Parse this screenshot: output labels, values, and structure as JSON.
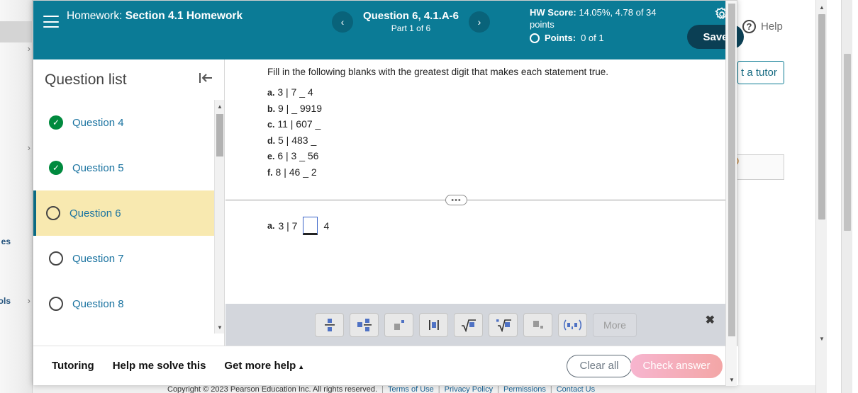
{
  "background": {
    "left_rail": {
      "fragment_1": "es",
      "fragment_2": "ols",
      "chevron": "›"
    },
    "help_label": "Help",
    "help_icon_glyph": "?",
    "tutor_button_label": "t a tutor",
    "inner_box_text": ")"
  },
  "footer": {
    "copyright": "Copyright © 2023 Pearson Education Inc. All rights reserved.",
    "links": [
      "Terms of Use",
      "Privacy Policy",
      "Permissions",
      "Contact Us"
    ],
    "separator": "|"
  },
  "header": {
    "menu_icon": "hamburger-icon",
    "assignment_prefix": "Homework:",
    "assignment_name": "Section 4.1 Homework",
    "prev_glyph": "‹",
    "next_glyph": "›",
    "question_title": "Question 6, 4.1.A-6",
    "part_label": "Part 1 of 6",
    "hw_score_label": "HW Score:",
    "hw_score_value": "14.05%, 4.78 of 34 points",
    "points_label": "Points:",
    "points_value": "0 of 1",
    "settings_icon": "gear-icon",
    "save_label": "Save",
    "accent_color": "#0b7b96",
    "save_color": "#0b3f54"
  },
  "question_list": {
    "title": "Question list",
    "collapse_icon": "collapse-left-icon",
    "items": [
      {
        "label": "Question 4",
        "state": "done",
        "active": false
      },
      {
        "label": "Question 5",
        "state": "done",
        "active": false
      },
      {
        "label": "Question 6",
        "state": "open",
        "active": true
      },
      {
        "label": "Question 7",
        "state": "open",
        "active": false
      },
      {
        "label": "Question 8",
        "state": "open",
        "active": false
      }
    ],
    "check_glyph": "✓",
    "highlight_color": "#f8e9b0",
    "link_color": "#1a73a0",
    "done_color": "#008a3e"
  },
  "question": {
    "prompt": "Fill in the following blanks with the greatest digit that makes each statement true.",
    "parts": [
      {
        "letter": "a.",
        "text": "3 | 7 _ 4"
      },
      {
        "letter": "b.",
        "text": "9 | _ 9919"
      },
      {
        "letter": "c.",
        "text": "11 | 607 _"
      },
      {
        "letter": "d.",
        "text": "5 | 483 _"
      },
      {
        "letter": "e.",
        "text": "6 | 3 _ 56"
      },
      {
        "letter": "f.",
        "text": "8 | 46 _ 2"
      }
    ],
    "divider_pill": "•••",
    "answer": {
      "letter": "a.",
      "before": "3 | 7",
      "after": "4",
      "input_value": "",
      "input_placeholder": ""
    }
  },
  "math_toolbar": {
    "buttons": [
      {
        "name": "fraction-button",
        "glyph": "fraction"
      },
      {
        "name": "mixed-fraction-button",
        "glyph": "mixed-fraction"
      },
      {
        "name": "exponent-button",
        "glyph": "exponent"
      },
      {
        "name": "absolute-value-button",
        "glyph": "absolute-value"
      },
      {
        "name": "square-root-button",
        "glyph": "square-root"
      },
      {
        "name": "nth-root-button",
        "glyph": "nth-root"
      },
      {
        "name": "subscript-button",
        "glyph": "subscript"
      },
      {
        "name": "interval-button",
        "glyph": "interval"
      }
    ],
    "more_label": "More",
    "close_glyph": "✖"
  },
  "action_bar": {
    "tutoring_label": "Tutoring",
    "help_solve_label": "Help me solve this",
    "get_more_help_label": "Get more help",
    "get_more_help_caret": "▲",
    "clear_all_label": "Clear all",
    "check_answer_label": "Check answer"
  },
  "scroll": {
    "up_glyph": "▲",
    "down_glyph": "▼"
  }
}
